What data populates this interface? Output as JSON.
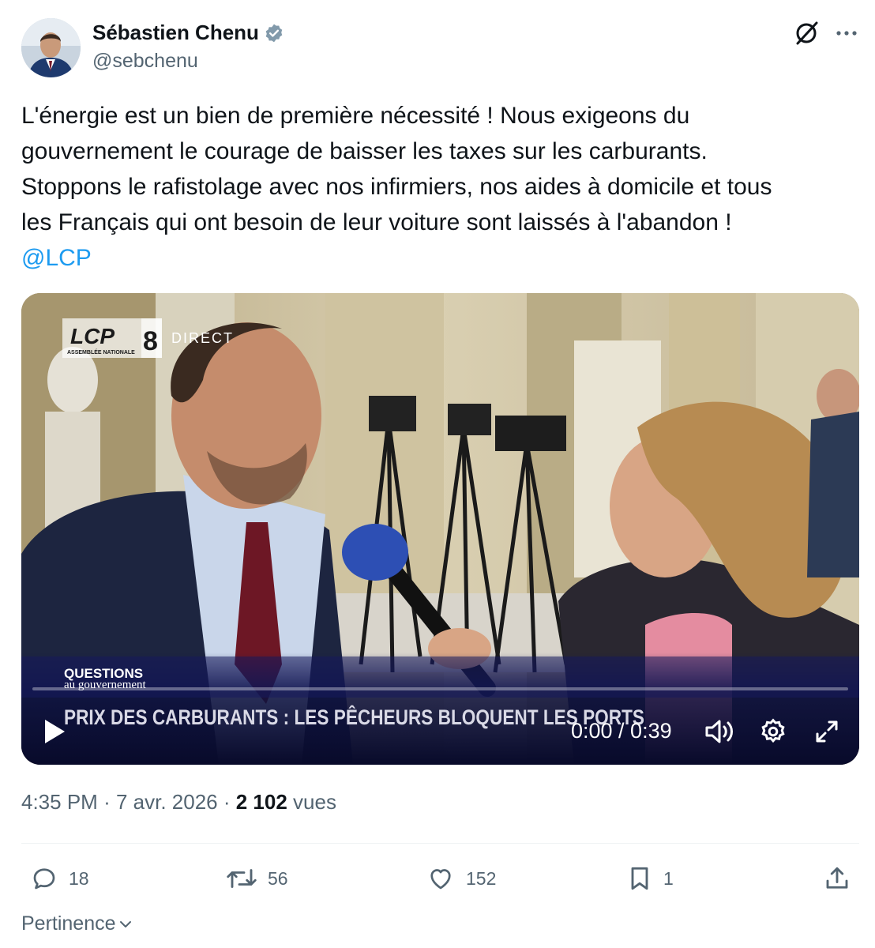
{
  "author": {
    "display_name": "Sébastien Chenu",
    "handle": "@sebchenu",
    "verified_icon": "verified-badge-icon"
  },
  "header": {
    "grok_icon": "grok-icon",
    "more_icon": "more-icon"
  },
  "tweet": {
    "lines": [
      "L'énergie est un bien de première nécessité ! Nous exigeons du",
      "gouvernement le courage de baisser les taxes sur les carburants.",
      "Stoppons le rafistolage avec nos infirmiers, nos aides à domicile et tous",
      "les Français qui ont besoin de leur voiture sont laissés à l'abandon !"
    ],
    "mention": "@LCP"
  },
  "video": {
    "channel_logo": "LCP",
    "channel_sub": "ASSEMBLÉE NATIONALE",
    "channel_number": "8",
    "live_label": "DIRECT",
    "show_title_top": "QUESTIONS",
    "show_title_bottom": "au gouvernement",
    "headline": "PRIX DES CARBURANTS : LES PÊCHEURS BLOQUENT LES PORTS",
    "timecode": "0:00 / 0:39",
    "progress": 0
  },
  "meta": {
    "time": "4:35 PM",
    "date": "7 avr. 2026",
    "views_count": "2 102",
    "views_label": "vues"
  },
  "actions": {
    "replies": "18",
    "reposts": "56",
    "likes": "152",
    "bookmarks": "1"
  },
  "sort": {
    "label": "Pertinence"
  },
  "colors": {
    "accent": "#1d9bf0",
    "text": "#0f1419",
    "muted": "#536471"
  }
}
